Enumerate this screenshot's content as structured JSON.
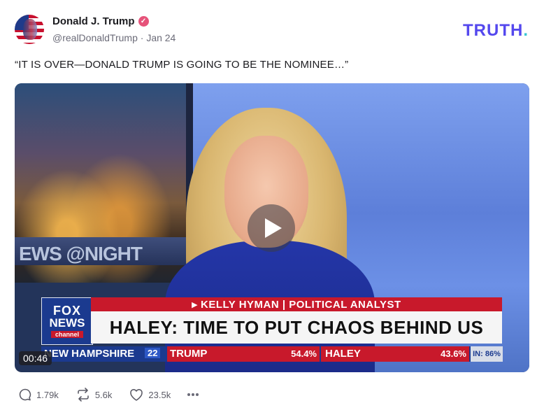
{
  "author": {
    "name": "Donald J. Trump",
    "handle": "@realDonaldTrump",
    "separator": "·",
    "date": "Jan 24"
  },
  "brand": {
    "logo": "TRUTH",
    "dot": "."
  },
  "post": {
    "text": "“IT IS OVER—DONALD TRUMP IS GOING TO BE THE NOMINEE…”"
  },
  "video": {
    "duration": "00:46",
    "overlay_text": "EWS @NIGHT",
    "chyron": {
      "top": "▸ KELLY HYMAN | POLITICAL ANALYST",
      "headline": "HALEY: TIME TO PUT CHAOS BEHIND US"
    },
    "fox_logo": {
      "line1": "FOX",
      "line2": "NEWS",
      "line3": "channel"
    },
    "ticker": {
      "state": "NEW HAMPSHIRE",
      "delegates": "22",
      "candidate1": "TRUMP",
      "candidate1_pct": "54.4%",
      "candidate2": "HALEY",
      "candidate2_pct": "43.6%",
      "reporting": "IN: 86%"
    }
  },
  "actions": {
    "replies": "1.79k",
    "retruths": "5.6k",
    "likes": "23.5k"
  },
  "colors": {
    "brand": "#5448ee",
    "verified": "#e6537a",
    "fox_blue": "#1b3a8f",
    "fox_red": "#c8192b"
  },
  "icons": [
    "verified-badge-icon",
    "play-icon",
    "reply-icon",
    "retruth-icon",
    "like-icon",
    "more-icon"
  ]
}
